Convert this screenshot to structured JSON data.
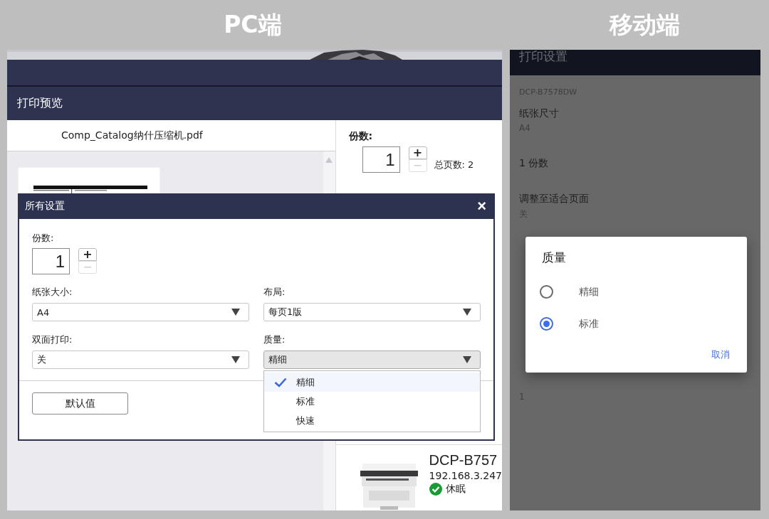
{
  "pc": {
    "heading": "PC端",
    "app_title": "打印预览",
    "file_name": "Comp_Catalog纳什压缩机.pdf",
    "copies": {
      "label": "份数:",
      "value": "1",
      "plus": "+",
      "minus": "−",
      "minus_disabled": true
    },
    "total_pages": "总页数: 2",
    "printer": {
      "name": "DCP-B757",
      "ip": "192.168.3.247",
      "status": "休眠",
      "status_ok": true
    },
    "dialog": {
      "title": "所有设置",
      "close": "×",
      "copies": {
        "label": "份数:",
        "value": "1",
        "plus": "+",
        "minus": "−",
        "minus_disabled": true
      },
      "fields": [
        {
          "label": "纸张大小:",
          "value": "A4",
          "open": false
        },
        {
          "label": "布局:",
          "value": "每页1版",
          "open": false
        },
        {
          "label": "双面打印:",
          "value": "关",
          "open": false
        },
        {
          "label": "质量:",
          "value": "精细",
          "open": true,
          "options": [
            {
              "label": "精细",
              "selected": true
            },
            {
              "label": "标准",
              "selected": false
            },
            {
              "label": "快速",
              "selected": false
            }
          ]
        }
      ],
      "default_button": "默认值"
    }
  },
  "mobile": {
    "heading": "移动端",
    "title": "打印设置",
    "printer": "DCP-B7578DW",
    "settings": [
      {
        "kind": "pair",
        "label": "纸张尺寸",
        "value": "A4"
      },
      {
        "kind": "single",
        "label": "1 份数"
      },
      {
        "kind": "pair",
        "label": "调整至适合页面",
        "value": "关"
      },
      {
        "kind": "value_only",
        "value": "1"
      }
    ],
    "dialog": {
      "title": "质量",
      "options": [
        {
          "label": "精细",
          "selected": false
        },
        {
          "label": "标准",
          "selected": true
        }
      ],
      "cancel": "取消"
    }
  }
}
